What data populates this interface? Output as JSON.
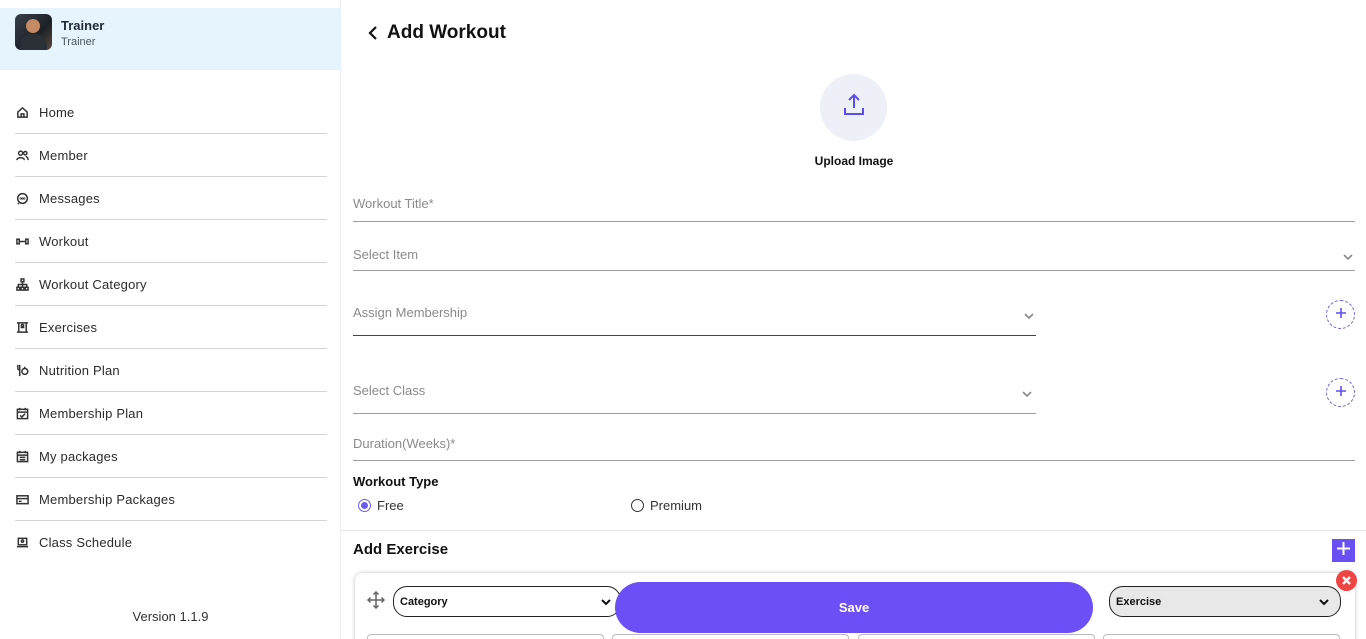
{
  "profile": {
    "name": "Trainer",
    "role": "Trainer"
  },
  "sidebar": {
    "items": [
      {
        "label": "Home",
        "icon": "home-icon"
      },
      {
        "label": "Member",
        "icon": "users-icon"
      },
      {
        "label": "Messages",
        "icon": "chat-icon"
      },
      {
        "label": "Workout",
        "icon": "dumbbell-icon"
      },
      {
        "label": "Workout Category",
        "icon": "hierarchy-icon"
      },
      {
        "label": "Exercises",
        "icon": "exercise-icon"
      },
      {
        "label": "Nutrition Plan",
        "icon": "nutrition-icon"
      },
      {
        "label": "Membership Plan",
        "icon": "calendar-check-icon"
      },
      {
        "label": "My packages",
        "icon": "calendar-list-icon"
      },
      {
        "label": "Membership Packages",
        "icon": "card-icon"
      },
      {
        "label": "Class Schedule",
        "icon": "laptop-icon"
      }
    ],
    "version": "Version 1.1.9"
  },
  "page": {
    "title": "Add Workout",
    "upload_label": "Upload Image"
  },
  "form": {
    "workout_title_placeholder": "Workout Title*",
    "select_item_placeholder": "Select Item",
    "assign_membership_placeholder": "Assign Membership",
    "select_class_placeholder": "Select Class",
    "duration_placeholder": "Duration(Weeks)*",
    "workout_type_label": "Workout Type",
    "workout_type_options": [
      "Free",
      "Premium"
    ],
    "workout_type_selected": "Free"
  },
  "exercise": {
    "section_title": "Add Exercise",
    "category_value": "Category",
    "exercise_value": "Exercise"
  },
  "actions": {
    "save_label": "Save"
  },
  "colors": {
    "accent": "#6c4ff7",
    "profile_bg": "#e6f4fd",
    "danger": "#ef4444"
  }
}
